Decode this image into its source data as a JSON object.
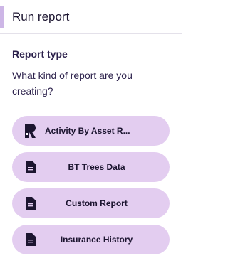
{
  "header": {
    "title": "Run report"
  },
  "form": {
    "section_label": "Report type",
    "question": "What kind of report are you creating?"
  },
  "options": [
    {
      "label": "Activity By Asset R...",
      "icon": "brand-r-logo-icon"
    },
    {
      "label": "BT Trees Data",
      "icon": "document-icon"
    },
    {
      "label": "Custom Report",
      "icon": "document-icon"
    },
    {
      "label": "Insurance History",
      "icon": "document-icon"
    }
  ],
  "colors": {
    "accent": "#cdb6e6",
    "option_bg": "#e3cdf0",
    "text_dark": "#1c1530"
  }
}
